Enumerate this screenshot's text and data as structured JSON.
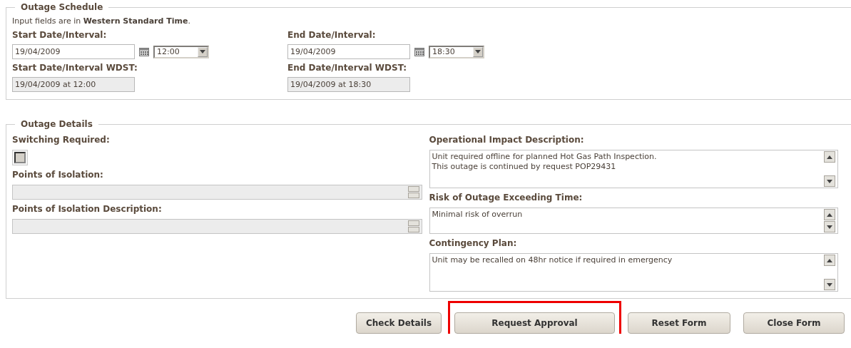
{
  "schedule": {
    "legend": "Outage Schedule",
    "note": "Input fields are in **Western Standard Time**.",
    "columns": [
      {
        "label": "Start Date/Interval:",
        "date": "19/04/2009",
        "time": "12:00",
        "wdst_label": "Start Date/Interval WDST:",
        "wdst_value": "19/04/2009 at 12:00"
      },
      {
        "label": "End Date/Interval:",
        "date": "19/04/2009",
        "time": "18:30",
        "wdst_label": "End Date/Interval WDST:",
        "wdst_value": "19/04/2009 at 18:30"
      }
    ]
  },
  "details": {
    "legend": "Outage Details",
    "switching": {
      "label": "Switching Required:",
      "checked": false
    },
    "isolation_fields": [
      {
        "label": "Points of Isolation:",
        "disabled": true
      },
      {
        "label": "Points of Isolation Description:",
        "disabled": true
      }
    ],
    "text_areas": [
      {
        "label": "Operational Impact Description:",
        "value": "Unit required offline for planned Hot Gas Path Inspection.\nThis outage is continued by request POP29431",
        "kind": "tall"
      },
      {
        "label": "Risk of Outage Exceeding Time:",
        "value": "Minimal risk of overrun",
        "kind": "short"
      },
      {
        "label": "Contingency Plan:",
        "value": "Unit may be recalled on 48hr notice if required in emergency",
        "kind": "tall"
      }
    ]
  },
  "buttons": [
    {
      "label": "Check Details",
      "highlighted": false
    },
    {
      "label": "Request Approval",
      "highlighted": true
    },
    {
      "label": "Reset Form",
      "highlighted": false
    },
    {
      "label": "Close Form",
      "highlighted": false
    }
  ]
}
